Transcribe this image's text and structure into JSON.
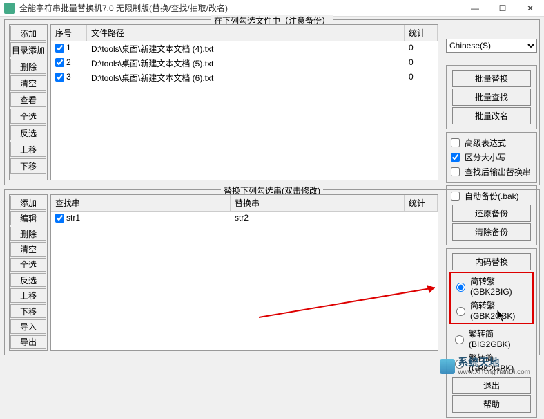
{
  "window": {
    "title": "全能字符串批量替换机7.0 无限制版(替换/查找/抽取/改名)",
    "btn_min": "—",
    "btn_max": "☐",
    "btn_close": "✕"
  },
  "top": {
    "legend": "在下列勾选文件中（注意备份）",
    "side_btns": [
      "添加",
      "目录添加",
      "删除",
      "清空",
      "查看",
      "全选",
      "反选",
      "上移",
      "下移"
    ],
    "headers": {
      "seq": "序号",
      "path": "文件路径",
      "stat": "统计"
    },
    "rows": [
      {
        "checked": true,
        "seq": "1",
        "path": "D:\\tools\\桌面\\新建文本文档 (4).txt",
        "stat": "0"
      },
      {
        "checked": true,
        "seq": "2",
        "path": "D:\\tools\\桌面\\新建文本文档 (5).txt",
        "stat": "0"
      },
      {
        "checked": true,
        "seq": "3",
        "path": "D:\\tools\\桌面\\新建文本文档 (6).txt",
        "stat": "0"
      }
    ]
  },
  "bottom": {
    "legend": "替换下列勾选串(双击修改)",
    "side_btns": [
      "添加",
      "编辑",
      "删除",
      "清空",
      "全选",
      "反选",
      "上移",
      "下移",
      "导入",
      "导出"
    ],
    "headers": {
      "find": "查找串",
      "replace": "替换串",
      "stat": "统计"
    },
    "rows": [
      {
        "checked": true,
        "find": "str1",
        "replace": "str2",
        "stat": ""
      }
    ]
  },
  "right": {
    "encoding": "Chinese(S)",
    "batch_btns": [
      "批量替换",
      "批量查找",
      "批量改名"
    ],
    "checks": [
      {
        "checked": false,
        "label": "高级表达式"
      },
      {
        "checked": true,
        "label": "区分大小写"
      },
      {
        "checked": false,
        "label": "查找后输出替换串"
      }
    ],
    "backup": {
      "auto": {
        "checked": false,
        "label": "自动备份(.bak)"
      },
      "restore": "还原备份",
      "clear": "清除备份"
    },
    "encode_btn": "内码替换",
    "radios1": [
      {
        "selected": true,
        "label": "简转繁(GBK2BIG)"
      },
      {
        "selected": false,
        "label": "简转繁(GBK2GBK)"
      }
    ],
    "radios2": [
      {
        "selected": false,
        "label": "繁转简(BIG2GBK)"
      },
      {
        "selected": false,
        "label": "繁转简(GBK2GBK)"
      }
    ],
    "exit": "退出",
    "help": "帮助"
  },
  "watermark": {
    "name": "系统天地",
    "url": "www.XiTongTianDi.com"
  }
}
